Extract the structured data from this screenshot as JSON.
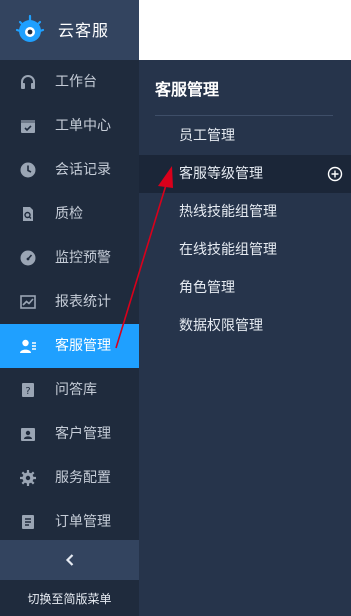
{
  "app": {
    "name": "云客服",
    "brand_color": "#1fa0ff"
  },
  "sidebar": {
    "items": [
      {
        "label": "工作台",
        "icon": "headset-icon"
      },
      {
        "label": "工单中心",
        "icon": "calendar-icon"
      },
      {
        "label": "会话记录",
        "icon": "clock-icon"
      },
      {
        "label": "质检",
        "icon": "document-icon"
      },
      {
        "label": "监控预警",
        "icon": "dashboard-icon"
      },
      {
        "label": "报表统计",
        "icon": "chart-icon"
      },
      {
        "label": "客服管理",
        "icon": "user-list-icon",
        "active": true
      },
      {
        "label": "问答库",
        "icon": "question-book-icon"
      },
      {
        "label": "客户管理",
        "icon": "contacts-icon"
      },
      {
        "label": "服务配置",
        "icon": "gear-icon"
      },
      {
        "label": "订单管理",
        "icon": "order-list-icon"
      }
    ],
    "collapse_label": "<",
    "switch_label": "切换至简版菜单"
  },
  "submenu": {
    "title": "客服管理",
    "items": [
      {
        "label": "员工管理"
      },
      {
        "label": "客服等级管理",
        "active": true
      },
      {
        "label": "热线技能组管理"
      },
      {
        "label": "在线技能组管理"
      },
      {
        "label": "角色管理"
      },
      {
        "label": "数据权限管理"
      }
    ]
  }
}
